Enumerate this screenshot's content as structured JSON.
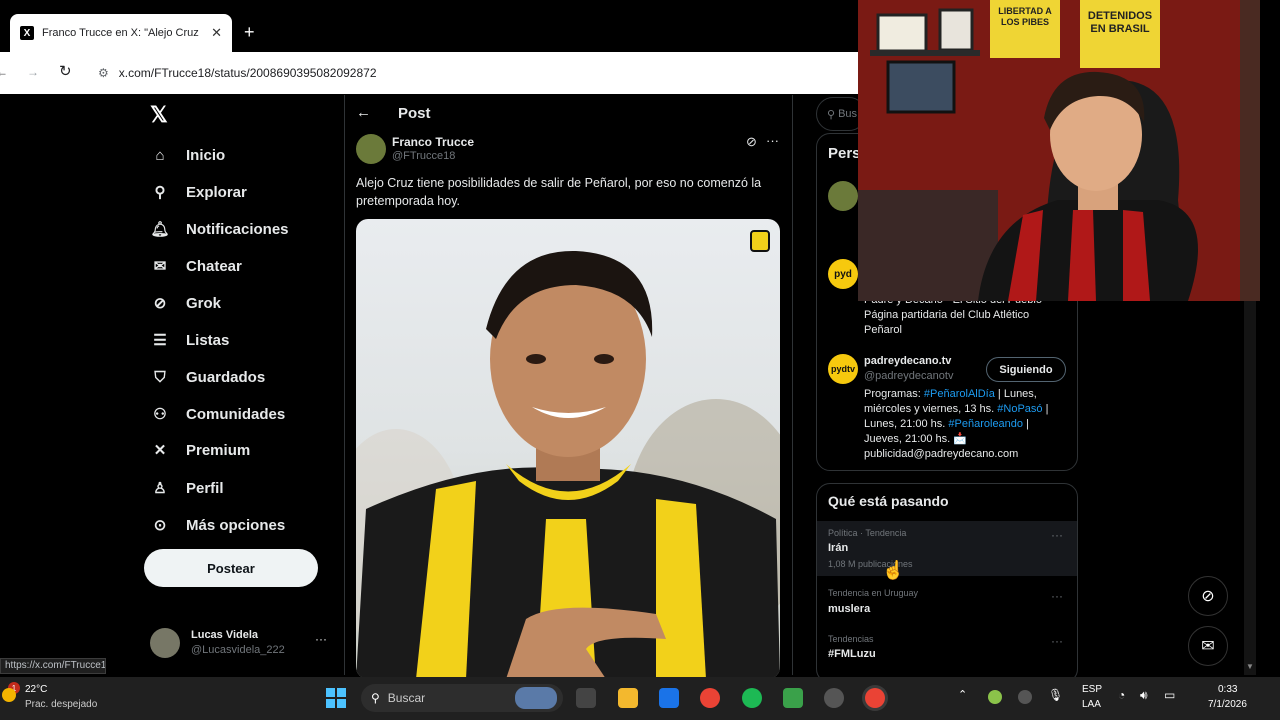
{
  "browser": {
    "tab_title": "Franco Trucce en X: \"Alejo Cruz",
    "url": "x.com/FTrucce18/status/2008690395082092872",
    "status_url": "https://x.com/FTrucce18"
  },
  "nav": {
    "items": [
      {
        "label": "Inicio",
        "icon": "home-icon"
      },
      {
        "label": "Explorar",
        "icon": "search-icon"
      },
      {
        "label": "Notificaciones",
        "icon": "bell-icon"
      },
      {
        "label": "Chatear",
        "icon": "mail-icon"
      },
      {
        "label": "Grok",
        "icon": "grok-icon"
      },
      {
        "label": "Listas",
        "icon": "list-icon"
      },
      {
        "label": "Guardados",
        "icon": "bookmark-icon"
      },
      {
        "label": "Comunidades",
        "icon": "people-icon"
      },
      {
        "label": "Premium",
        "icon": "x-icon"
      },
      {
        "label": "Perfil",
        "icon": "person-icon"
      },
      {
        "label": "Más opciones",
        "icon": "more-icon"
      }
    ],
    "post_button": "Postear",
    "user_name": "Lucas Videla",
    "user_handle": "@Lucasvidela_222"
  },
  "post": {
    "header": "Post",
    "author_name": "Franco Trucce",
    "author_handle": "@FTrucce18",
    "text": "Alejo Cruz tiene posibilidades de salir de Peñarol, por eso no comenzó la pretemporada hoy."
  },
  "right": {
    "search_placeholder": "Bus",
    "who_title": "Pers",
    "account1_bio": "Padre y Decano - El Sitio del Pueblo - Página partidaria del Club Atlético Peñarol",
    "account2_logo": "pyd",
    "account2_name": "padreydecano.tv",
    "account2_handle": "@padreydecanotv",
    "account2_logo_b": "pydtv",
    "follow_label": "Siguiendo",
    "account2_bio_a": "Programas: ",
    "account2_bio_tag1": "#PeñarolAlDía",
    "account2_bio_b": " | Lunes, miércoles y viernes, 13 hs. ",
    "account2_bio_tag2": "#NoPasó",
    "account2_bio_c": " | Lunes, 21:00 hs. ",
    "account2_bio_tag3": "#Peñaroleando",
    "account2_bio_d": " | Jueves, 21:00 hs. 📩 publicidad@padreydecano.com",
    "trends_title": "Qué está pasando",
    "trends": [
      {
        "meta": "Política · Tendencia",
        "name": "Irán",
        "count": "1,08 M publicaciones"
      },
      {
        "meta": "Tendencia en Uruguay",
        "name": "muslera",
        "count": ""
      },
      {
        "meta": "Tendencias",
        "name": "#FMLuzu",
        "count": ""
      }
    ]
  },
  "webcam": {
    "sign1": "LIBERTAD A LOS PIBES",
    "sign2": "DETENIDOS EN BRASIL"
  },
  "taskbar": {
    "weather_temp": "22°C",
    "weather_desc": "Prac. despejado",
    "search_label": "Buscar",
    "lang1": "ESP",
    "lang2": "LAA",
    "time": "0:33",
    "date": "7/1/2026",
    "notif_count": "1"
  },
  "colors": {
    "accent": "#1d9bf0",
    "penarol_yellow": "#f6c90e"
  }
}
